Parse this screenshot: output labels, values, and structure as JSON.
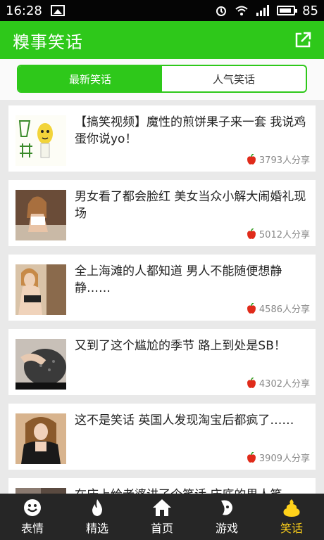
{
  "status": {
    "time": "16:28",
    "battery": "85"
  },
  "header": {
    "title": "糗事笑话"
  },
  "tabs": [
    {
      "label": "最新笑话",
      "active": true
    },
    {
      "label": "人气笑话",
      "active": false
    }
  ],
  "items": [
    {
      "title": "【搞笑视频】魔性的煎饼果子来一套 我说鸡蛋你说yo！",
      "shares": "3793人分享"
    },
    {
      "title": "男女看了都会脸红 美女当众小解大闹婚礼现场",
      "shares": "5012人分享"
    },
    {
      "title": "全上海滩的人都知道 男人不能随便想静静……",
      "shares": "4586人分享"
    },
    {
      "title": "又到了这个尴尬的季节 路上到处是SB！",
      "shares": "4302人分享"
    },
    {
      "title": "这不是笑话 英国人发现淘宝后都疯了……",
      "shares": "3909人分享"
    },
    {
      "title": "在床上给老婆讲了个笑话 床底的男人笑",
      "shares": ""
    }
  ],
  "bottom_nav": [
    {
      "label": "表情",
      "icon": "smiley-icon",
      "active": false
    },
    {
      "label": "精选",
      "icon": "flame-icon",
      "active": false
    },
    {
      "label": "首页",
      "icon": "home-icon",
      "active": false
    },
    {
      "label": "游戏",
      "icon": "game-icon",
      "active": false
    },
    {
      "label": "笑话",
      "icon": "joke-icon",
      "active": true
    }
  ],
  "colors": {
    "accent": "#2ec81a",
    "nav_bg": "#262626",
    "nav_active": "#ffd21a"
  }
}
